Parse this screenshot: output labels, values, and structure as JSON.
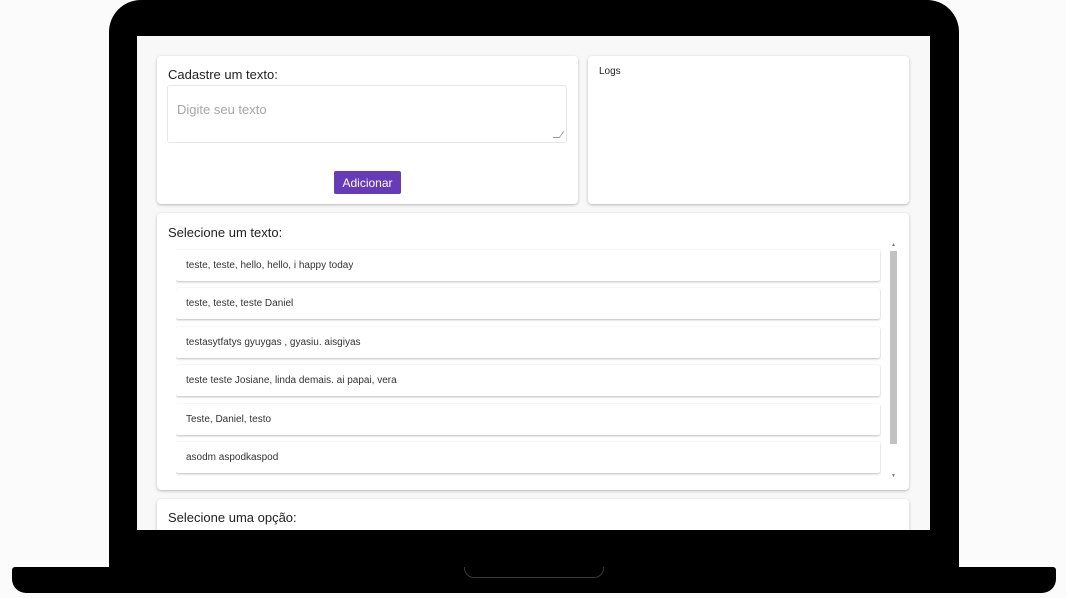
{
  "form": {
    "title": "Cadastre um texto:",
    "placeholder": "Digite seu texto",
    "value": "",
    "add_button": "Adicionar"
  },
  "logs": {
    "title": "Logs"
  },
  "select_text": {
    "title": "Selecione um texto:",
    "items": [
      {
        "text": "teste, teste, hello, hello, i happy today"
      },
      {
        "text": "teste, teste, teste Daniel"
      },
      {
        "text": "testasytfatys gyuygas , gyasiu. aisgiyas"
      },
      {
        "text": "teste teste Josiane, linda demais. ai papai, vera"
      },
      {
        "text": "Teste, Daniel, testo"
      },
      {
        "text": "asodm aspodkaspod"
      }
    ],
    "scroll_up": "▲",
    "scroll_down": "▼"
  },
  "select_option": {
    "title": "Selecione uma opção:"
  },
  "colors": {
    "accent": "#673ab7",
    "frame": "#000000",
    "screen_bg": "#f8f8f8"
  }
}
